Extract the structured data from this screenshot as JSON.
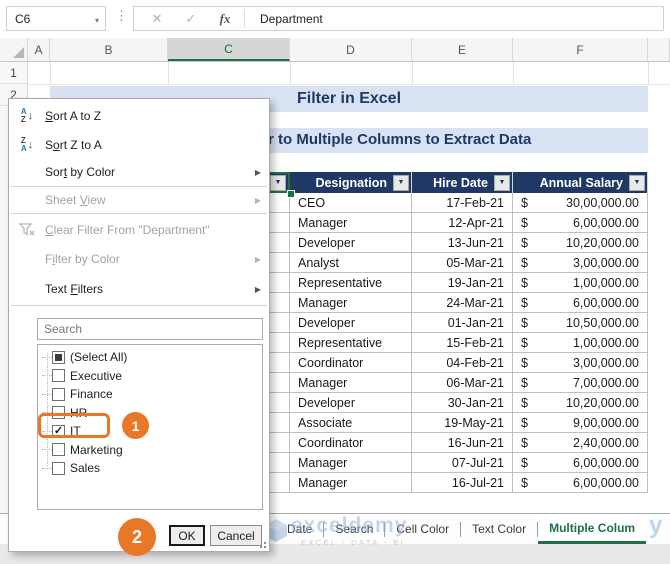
{
  "formula_bar": {
    "name_box_value": "C6",
    "cancel_glyph": "✕",
    "confirm_glyph": "✓",
    "fx_glyph": "fx",
    "dropdown_glyph": "▾",
    "dots_glyph": "⋮",
    "value": "Department"
  },
  "grid": {
    "columns": [
      "A",
      "B",
      "C",
      "D",
      "E",
      "F"
    ],
    "selected_column": "C",
    "visible_row_numbers": [
      "1",
      "2"
    ]
  },
  "banners": {
    "title": "Filter in Excel",
    "subtitle_fragment": "r to Multiple Columns to Extract Data"
  },
  "table": {
    "headers": [
      "Designation",
      "Hire Date",
      "Annual Salary"
    ],
    "filter_arrow_glyph": "▼",
    "rows": [
      {
        "designation": "CEO",
        "hire_date": "17-Feb-21",
        "currency": "$",
        "salary": "30,00,000.00"
      },
      {
        "designation": "Manager",
        "hire_date": "12-Apr-21",
        "currency": "$",
        "salary": "6,00,000.00"
      },
      {
        "designation": "Developer",
        "hire_date": "13-Jun-21",
        "currency": "$",
        "salary": "10,20,000.00"
      },
      {
        "designation": "Analyst",
        "hire_date": "05-Mar-21",
        "currency": "$",
        "salary": "3,00,000.00"
      },
      {
        "designation": "Representative",
        "hire_date": "19-Jan-21",
        "currency": "$",
        "salary": "1,00,000.00"
      },
      {
        "designation": "Manager",
        "hire_date": "24-Mar-21",
        "currency": "$",
        "salary": "6,00,000.00"
      },
      {
        "designation": "Developer",
        "hire_date": "01-Jan-21",
        "currency": "$",
        "salary": "10,50,000.00"
      },
      {
        "designation": "Representative",
        "hire_date": "15-Feb-21",
        "currency": "$",
        "salary": "1,00,000.00"
      },
      {
        "designation": "Coordinator",
        "hire_date": "04-Feb-21",
        "currency": "$",
        "salary": "3,00,000.00"
      },
      {
        "designation": "Manager",
        "hire_date": "06-Mar-21",
        "currency": "$",
        "salary": "7,00,000.00"
      },
      {
        "designation": "Developer",
        "hire_date": "30-Jan-21",
        "currency": "$",
        "salary": "10,20,000.00"
      },
      {
        "designation": "Associate",
        "hire_date": "19-May-21",
        "currency": "$",
        "salary": "9,00,000.00"
      },
      {
        "designation": "Coordinator",
        "hire_date": "16-Jun-21",
        "currency": "$",
        "salary": "2,40,000.00"
      },
      {
        "designation": "Manager",
        "hire_date": "07-Jul-21",
        "currency": "$",
        "salary": "6,00,000.00"
      },
      {
        "designation": "Manager",
        "hire_date": "16-Jul-21",
        "currency": "$",
        "salary": "6,00,000.00"
      }
    ]
  },
  "filter_menu": {
    "items": [
      {
        "id": "sort-a-to-z",
        "label": "Sort A to Z",
        "underline": 0,
        "icon": "sort-az",
        "disabled": false,
        "submenu": false,
        "sep_after": false
      },
      {
        "id": "sort-z-to-a",
        "label": "Sort Z to A",
        "underline": 1,
        "icon": "sort-za",
        "disabled": false,
        "submenu": false,
        "sep_after": false
      },
      {
        "id": "sort-by-color",
        "label": "Sort by Color",
        "underline": 3,
        "icon": "",
        "disabled": false,
        "submenu": true,
        "sep_after": true
      },
      {
        "id": "sheet-view",
        "label": "Sheet View",
        "underline": 6,
        "icon": "",
        "disabled": true,
        "submenu": true,
        "sep_after": true
      },
      {
        "id": "clear-filter",
        "label": "Clear Filter From \"Department\"",
        "underline": 0,
        "icon": "clear-filter",
        "disabled": true,
        "submenu": false,
        "sep_after": false
      },
      {
        "id": "filter-by-color",
        "label": "Filter by Color",
        "underline": 1,
        "icon": "",
        "disabled": true,
        "submenu": true,
        "sep_after": false
      },
      {
        "id": "text-filters",
        "label": "Text Filters",
        "underline": 5,
        "icon": "",
        "disabled": false,
        "submenu": true,
        "sep_after": true
      }
    ],
    "submenu_arrow_glyph": "▶",
    "search_placeholder": "Search",
    "checkbox_items": [
      {
        "label": "(Select All)",
        "state": "indeterminate",
        "highlighted": false
      },
      {
        "label": "Executive",
        "state": "unchecked",
        "highlighted": false
      },
      {
        "label": "Finance",
        "state": "unchecked",
        "highlighted": false
      },
      {
        "label": "HR",
        "state": "unchecked",
        "highlighted": false
      },
      {
        "label": "IT",
        "state": "checked",
        "highlighted": true
      },
      {
        "label": "Marketing",
        "state": "unchecked",
        "highlighted": false
      },
      {
        "label": "Sales",
        "state": "unchecked",
        "highlighted": false
      }
    ],
    "check_glyph": "✓",
    "ok_label": "OK",
    "cancel_label": "Cancel"
  },
  "annotations": {
    "step1_badge": "1",
    "step2_badge": "2"
  },
  "sheet_tabs": [
    {
      "label": "Date",
      "active": false
    },
    {
      "label": "Search",
      "active": false
    },
    {
      "label": "Cell Color",
      "active": false
    },
    {
      "label": "Text Color",
      "active": false
    },
    {
      "label": "Multiple Colum",
      "active": true
    }
  ],
  "watermark": {
    "brand": "exceldemy",
    "tagline": "EXCEL - DATA - BI",
    "edge_fragment": "y"
  },
  "colors": {
    "header_navy": "#1f3864",
    "banner_bg": "#d9e2f3",
    "excel_green": "#1e7145",
    "annotation_orange": "#e87728",
    "watermark_blue": "#8fb4dd"
  }
}
